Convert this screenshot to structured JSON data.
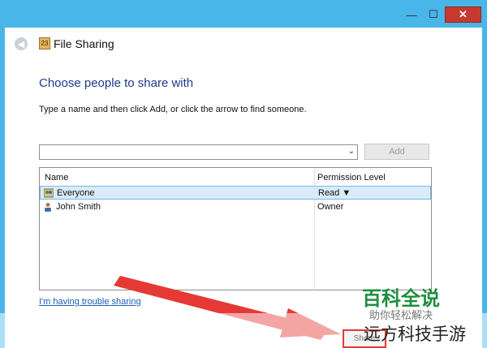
{
  "titlebar": {
    "minimize_glyph": "—",
    "maximize_glyph": "☐",
    "close_glyph": "✕"
  },
  "header": {
    "back_glyph": "◀",
    "app_icon_glyph": "23",
    "title": "File Sharing"
  },
  "main": {
    "heading": "Choose people to share with",
    "instruction": "Type a name and then click Add, or click the arrow to find someone.",
    "name_input_value": "",
    "dropdown_glyph": "⌄",
    "add_button": "Add",
    "columns": {
      "name": "Name",
      "permission": "Permission Level"
    },
    "rows": [
      {
        "name": "Everyone",
        "permission": "Read ▼",
        "icon": "group-icon",
        "selected": true
      },
      {
        "name": "John Smith",
        "permission": "Owner",
        "icon": "user-icon",
        "selected": false
      }
    ],
    "trouble_link": "I'm having trouble sharing",
    "share_button": "Share"
  },
  "watermark": {
    "brand_cn": "百科全说",
    "brand_sub": "助你轻松解决",
    "site_cn": "远方科技手游"
  },
  "colors": {
    "accent_blue": "#1e3a8a",
    "close_red": "#c7392f",
    "annotation_arrow": "#e53935",
    "selection": "#d9ebf9"
  }
}
